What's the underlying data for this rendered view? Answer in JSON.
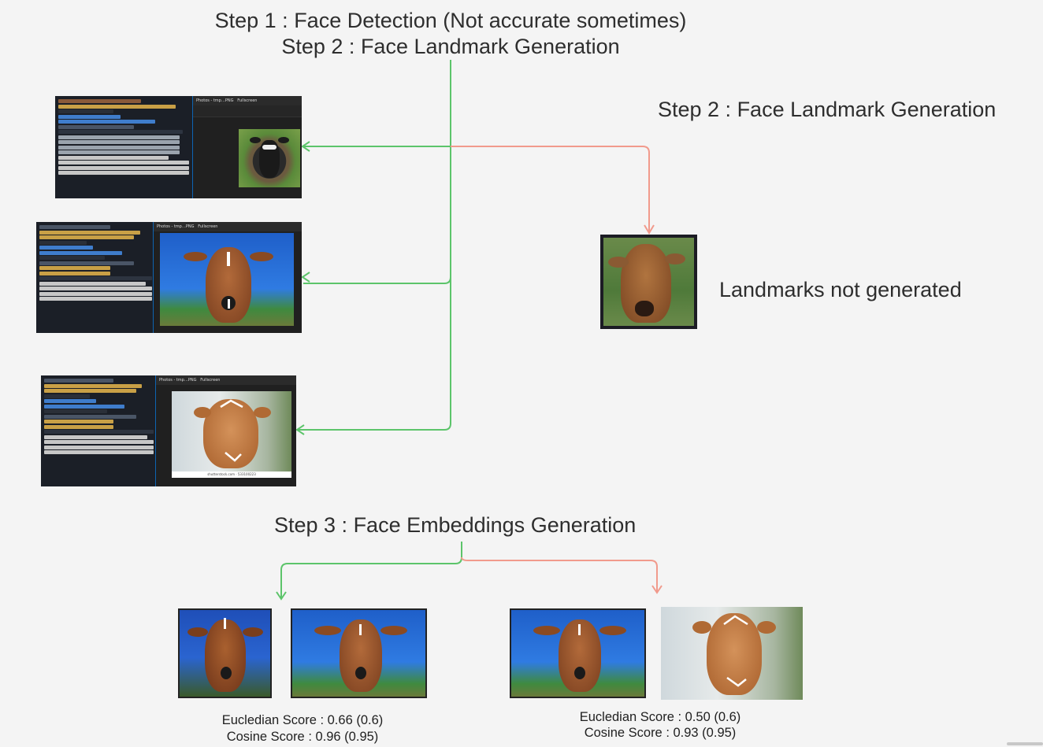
{
  "headings": {
    "step1": "Step 1 : Face Detection (Not accurate sometimes)",
    "step2_top": "Step 2 : Face Landmark Generation",
    "step2_right": "Step 2 : Face Landmark Generation",
    "step3": "Step 3 : Face Embeddings Generation"
  },
  "notes": {
    "landmarks_failed": "Landmarks not generated"
  },
  "scores": {
    "left": {
      "euclidean": "Eucledian Score : 0.66 (0.6)",
      "cosine": "Cosine Score : 0.96 (0.95)"
    },
    "right": {
      "euclidean": "Eucledian Score : 0.50 (0.6)",
      "cosine": "Cosine Score : 0.93 (0.95)"
    }
  },
  "colors": {
    "success_arrow": "#5cc46a",
    "failure_arrow": "#f19a8c",
    "background": "#f4f4f4"
  },
  "screenshots": {
    "first": {
      "viewer_title": "Photos - tmp…PNG",
      "fullscreen": "Fullscreen"
    },
    "second": {
      "viewer_title": "Photos - tmp…PNG",
      "fullscreen": "Fullscreen"
    },
    "third": {
      "viewer_title": "Photos - tmp…PNG",
      "fullscreen": "Fullscreen",
      "watermark": "shutterstock.com · 533100223"
    }
  }
}
